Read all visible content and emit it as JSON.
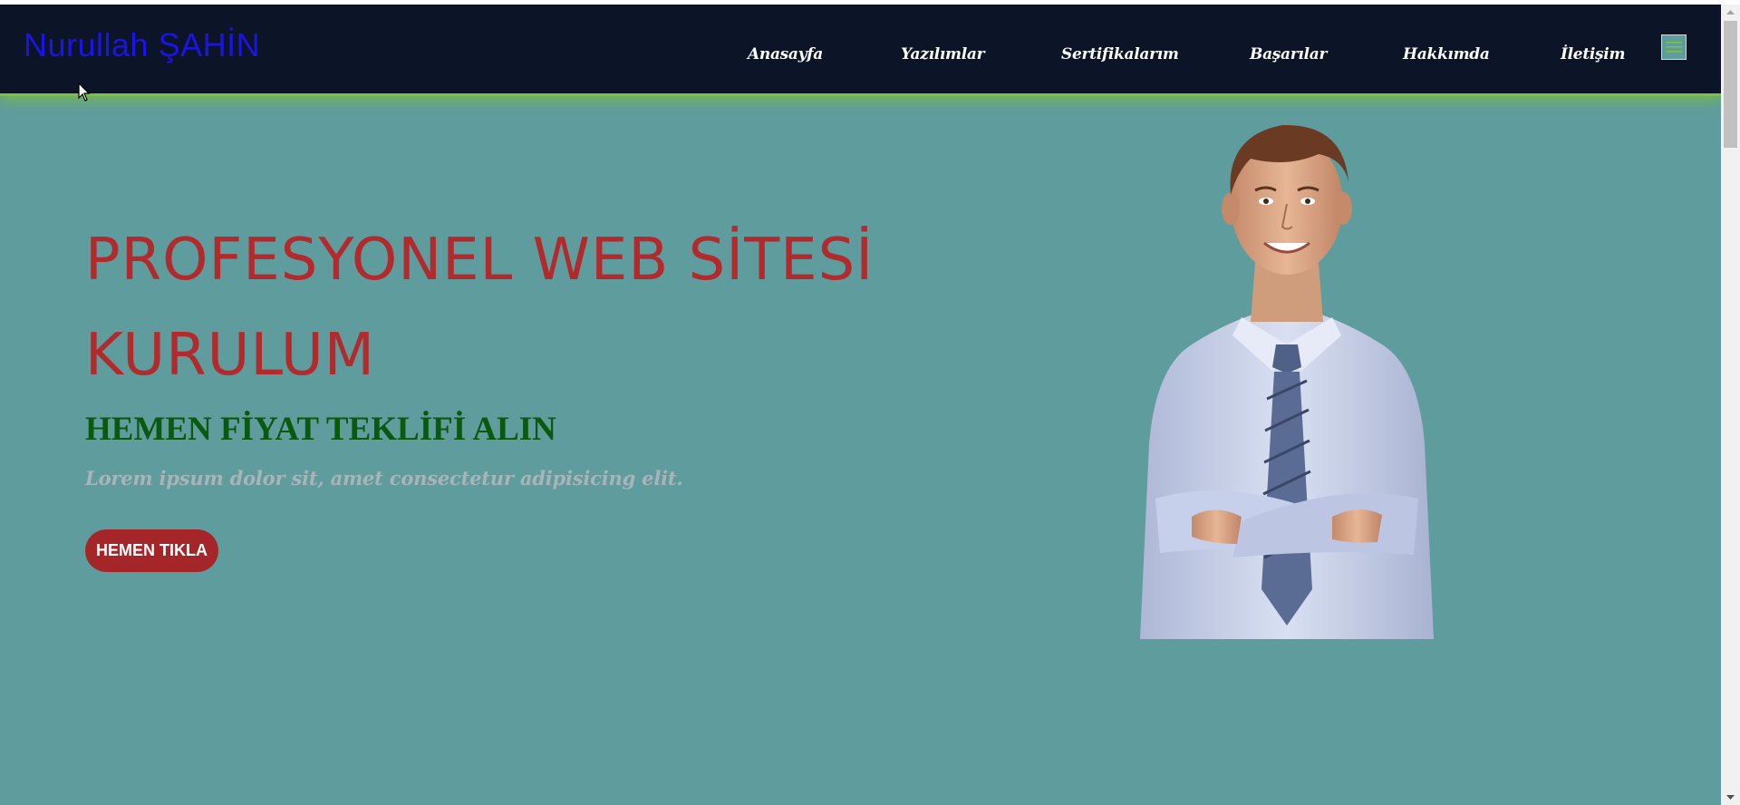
{
  "header": {
    "logo": "Nurullah ŞAHİN",
    "nav": [
      {
        "label": "Anasayfa"
      },
      {
        "label": "Yazılımlar"
      },
      {
        "label": "Sertifikalarım"
      },
      {
        "label": "Başarılar"
      },
      {
        "label": "Hakkımda"
      },
      {
        "label": "İletişim"
      }
    ],
    "menu_icon": "hamburger-menu-icon"
  },
  "hero": {
    "title": "PROFESYONEL WEB SİTESİ KURULUM",
    "subtitle": "HEMEN FİYAT TEKLİFİ ALIN",
    "text": "Lorem ipsum dolor sit, amet consectetur adipisicing elit.",
    "button_label": "HEMEN TIKLA",
    "image": "smiling-businessman-arms-crossed"
  },
  "colors": {
    "navbar_bg": "#0c1527",
    "navbar_border": "#7cc142",
    "page_bg": "#5f9c9e",
    "logo": "#1a14e6",
    "title": "#b22a2c",
    "subtitle": "#0a5a0e",
    "text": "#a9b4b8",
    "button": "#a52628"
  }
}
